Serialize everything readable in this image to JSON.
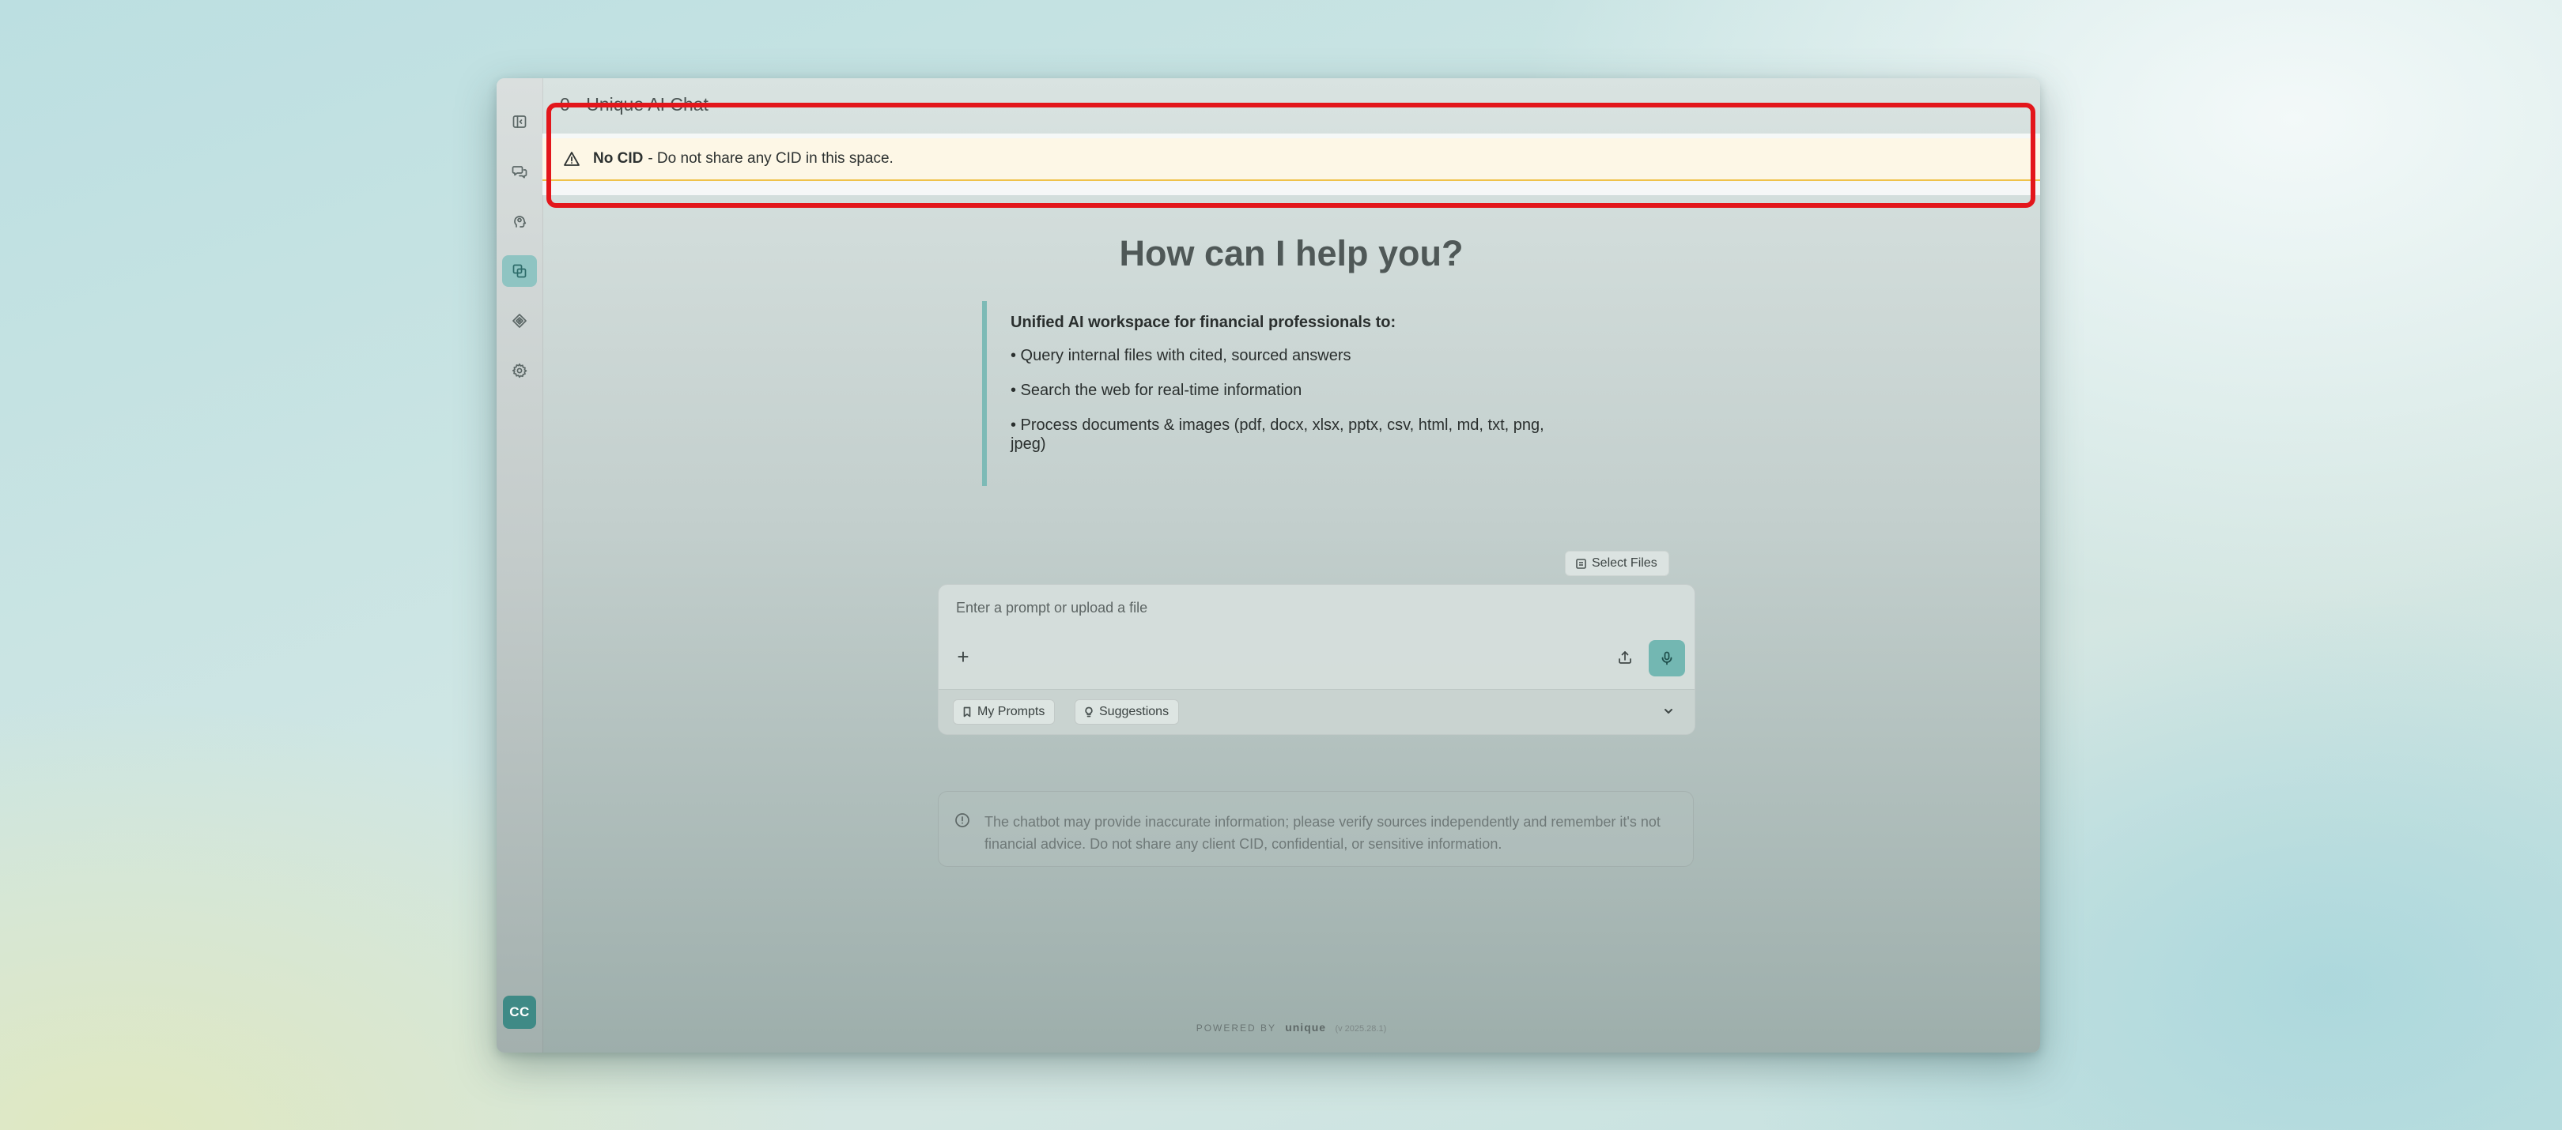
{
  "sidebar": {
    "items": [
      {
        "name": "collapse-sidebar",
        "icon": "sidebar-toggle-icon",
        "active": false
      },
      {
        "name": "chats",
        "icon": "chat-bubbles-icon",
        "active": false
      },
      {
        "name": "assistants",
        "icon": "brain-icon",
        "active": false
      },
      {
        "name": "spaces",
        "icon": "layers-copy-icon",
        "active": true
      },
      {
        "name": "knowledge",
        "icon": "target-diamond-icon",
        "active": false
      },
      {
        "name": "settings",
        "icon": "gear-icon",
        "active": false
      }
    ],
    "user_initials": "CC"
  },
  "header": {
    "title": "0 - Unique AI Chat"
  },
  "notice": {
    "icon": "warning-triangle-icon",
    "bold_label": "No CID",
    "text": "- Do not share any CID in this space."
  },
  "main": {
    "headline": "How can I help you?",
    "intro": {
      "lead": "Unified AI workspace for financial professionals to:",
      "bullets": [
        "• Query internal files with cited, sourced answers",
        "• Search the web for real-time information",
        "• Process documents & images (pdf, docx, xlsx, pptx, csv, html, md, txt, png, jpeg)"
      ]
    }
  },
  "composer": {
    "select_files_label": "Select Files",
    "placeholder": "Enter a prompt or upload a file",
    "plus_label": "+",
    "my_prompts_label": "My Prompts",
    "suggestions_label": "Suggestions"
  },
  "disclaimer": {
    "text": "The chatbot may provide inaccurate information; please verify sources independently and remember it's not financial advice. Do not share any client CID, confidential, or sensitive information."
  },
  "footer": {
    "powered_by": "POWERED BY",
    "brand": "unique",
    "version": "(v 2025.28.1)"
  },
  "colors": {
    "accent": "#73b7b2",
    "active_sidebar": "#8fc4c2",
    "avatar": "#3f8a86",
    "warning_bg": "#fdf7e6",
    "warning_border": "#efc24a",
    "annotation_red": "#e3161b"
  }
}
